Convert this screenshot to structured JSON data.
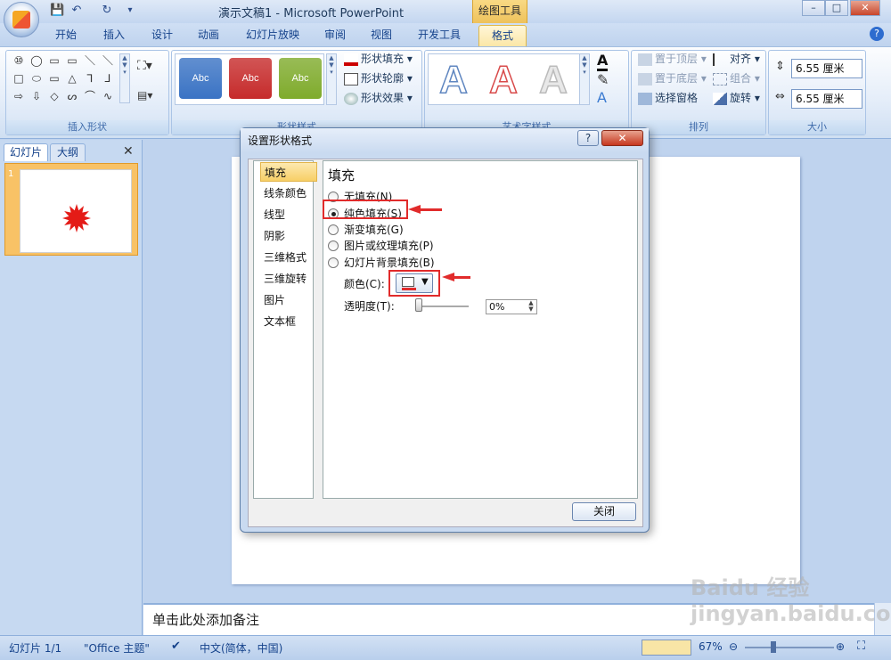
{
  "window": {
    "title": "演示文稿1 - Microsoft PowerPoint",
    "contextual_tab": "绘图工具",
    "minimize": "–",
    "maximize": "□",
    "close": "✕"
  },
  "tabs": [
    "开始",
    "插入",
    "设计",
    "动画",
    "幻灯片放映",
    "审阅",
    "视图",
    "开发工具",
    "格式"
  ],
  "active_tab": "格式",
  "ribbon": {
    "insert_shapes": {
      "label": "插入形状",
      "rows": [
        [
          "⑩",
          "◯",
          "▭",
          "▭",
          "＼",
          "＼"
        ],
        [
          "□",
          "⬭",
          "▭",
          "△",
          "⅂",
          "⅃"
        ],
        [
          "⇨",
          "⇩",
          "◇",
          "ᔕ",
          "⌒",
          "∿"
        ]
      ]
    },
    "shape_styles": {
      "label": "形状样式",
      "swatches": [
        {
          "text": "Abc",
          "color": "#3a73c4"
        },
        {
          "text": "Abc",
          "color": "#c62b2b"
        },
        {
          "text": "Abc",
          "color": "#7fab2c"
        }
      ],
      "fill": "形状填充",
      "outline": "形状轮廓",
      "effect": "形状效果"
    },
    "wordart_styles": {
      "label": "艺术字样式",
      "samples": [
        {
          "glyph": "A",
          "color": "#5f86c0"
        },
        {
          "glyph": "A",
          "color": "#d84a4a"
        },
        {
          "glyph": "A",
          "color": "#e8e8e8"
        }
      ]
    },
    "arrange": {
      "label": "排列",
      "bring_front": "置于顶层",
      "send_back": "置于底层",
      "selection_pane": "选择窗格",
      "align": "对齐",
      "group": "组合",
      "rotate": "旋转"
    },
    "size": {
      "label": "大小",
      "height": "6.55 厘米",
      "width": "6.55 厘米"
    }
  },
  "left_pane": {
    "tab_slides": "幻灯片",
    "tab_outline": "大纲",
    "slide_number": "1"
  },
  "notes_placeholder": "单击此处添加备注",
  "status": {
    "slide": "幻灯片 1/1",
    "theme": "\"Office 主题\"",
    "language": "中文(简体，中国)",
    "zoom": "67%"
  },
  "dialog": {
    "title": "设置形状格式",
    "help": "?",
    "close_x": "✕",
    "nav": [
      "填充",
      "线条颜色",
      "线型",
      "阴影",
      "三维格式",
      "三维旋转",
      "图片",
      "文本框"
    ],
    "selected_nav": "填充",
    "section_title": "填充",
    "options": [
      {
        "label": "无填充(N)",
        "checked": false
      },
      {
        "label": "纯色填充(S)",
        "checked": true
      },
      {
        "label": "渐变填充(G)",
        "checked": false
      },
      {
        "label": "图片或纹理填充(P)",
        "checked": false
      },
      {
        "label": "幻灯片背景填充(B)",
        "checked": false
      }
    ],
    "color_label": "颜色(C):",
    "transparency_label": "透明度(T):",
    "transparency_value": "0%",
    "close_button": "关闭"
  },
  "watermark": "Baidu 经验\njingyan.baidu.com"
}
